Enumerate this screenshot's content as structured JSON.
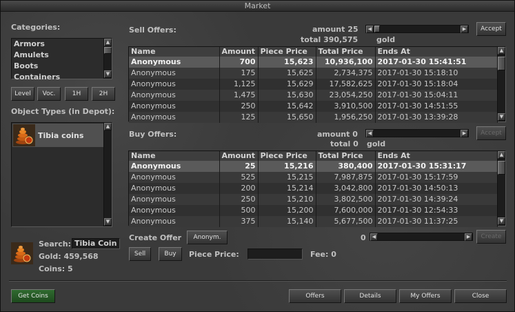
{
  "window": {
    "title": "Market"
  },
  "categories": {
    "label": "Categories:",
    "items": [
      "Armors",
      "Amulets",
      "Boots",
      "Containers"
    ]
  },
  "filters": [
    "Level",
    "Voc.",
    "1H",
    "2H"
  ],
  "object_types": {
    "label": "Object Types (in Depot):",
    "items": [
      {
        "name": "Tibia coins",
        "icon": "tibia-coin-icon"
      }
    ]
  },
  "search": {
    "label": "Search:",
    "value": "Tibia Coin"
  },
  "balance": {
    "gold": "Gold: 459,568",
    "coins": "Coins: 5"
  },
  "sell": {
    "label": "Sell Offers:",
    "amount_label": "amount 25",
    "total_label": "total 390,575",
    "gold_label": "gold",
    "accept": "Accept",
    "columns": [
      "Name",
      "Amount",
      "Piece Price",
      "Total Price",
      "Ends At"
    ],
    "rows": [
      [
        "Anonymous",
        "700",
        "15,623",
        "10,936,100",
        "2017-01-30 15:41:51"
      ],
      [
        "Anonymous",
        "175",
        "15,625",
        "2,734,375",
        "2017-01-30 15:18:10"
      ],
      [
        "Anonymous",
        "1,125",
        "15,629",
        "17,582,625",
        "2017-01-30 15:18:04"
      ],
      [
        "Anonymous",
        "1,475",
        "15,630",
        "23,054,250",
        "2017-01-30 15:04:11"
      ],
      [
        "Anonymous",
        "250",
        "15,642",
        "3,910,500",
        "2017-01-30 14:51:55"
      ],
      [
        "Anonymous",
        "125",
        "15,650",
        "1,956,250",
        "2017-01-30 13:39:28"
      ]
    ]
  },
  "buy": {
    "label": "Buy Offers:",
    "amount_label": "amount 0",
    "total_label": "total 0",
    "gold_label": "gold",
    "accept": "Accept",
    "columns": [
      "Name",
      "Amount",
      "Piece Price",
      "Total Price",
      "Ends At"
    ],
    "rows": [
      [
        "Anonymous",
        "25",
        "15,216",
        "380,400",
        "2017-01-30 15:31:17"
      ],
      [
        "Anonymous",
        "525",
        "15,215",
        "7,987,875",
        "2017-01-30 15:17:59"
      ],
      [
        "Anonymous",
        "200",
        "15,214",
        "3,042,800",
        "2017-01-30 14:50:13"
      ],
      [
        "Anonymous",
        "250",
        "15,210",
        "3,802,500",
        "2017-01-30 14:39:24"
      ],
      [
        "Anonymous",
        "500",
        "15,200",
        "7,600,000",
        "2017-01-30 12:54:33"
      ],
      [
        "Anonymous",
        "375",
        "15,140",
        "5,677,500",
        "2017-01-30 11:37:25"
      ]
    ]
  },
  "create_offer": {
    "label": "Create Offer",
    "anonym": "Anonym.",
    "sell": "Sell",
    "buy": "Buy",
    "piece_price_label": "Piece Price:",
    "piece_price_value": "",
    "fee_label": "Fee: 0",
    "amount_value": "0",
    "create": "Create"
  },
  "footer": {
    "get_coins": "Get Coins",
    "offers": "Offers",
    "details": "Details",
    "my_offers": "My Offers",
    "close": "Close"
  },
  "colors": {
    "background": "#3a3a3a",
    "selected_row": "#5a5a5a",
    "get_coins": "#2f6a2f"
  }
}
